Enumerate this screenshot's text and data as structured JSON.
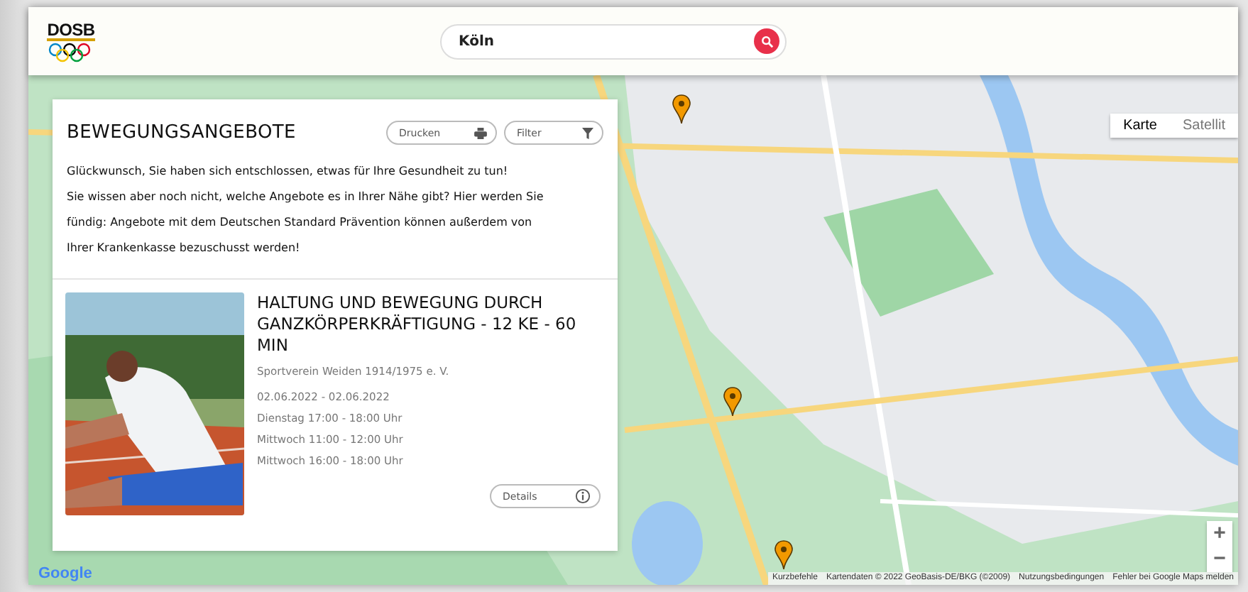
{
  "header": {
    "logo": "DOSB",
    "search": {
      "value": "Köln"
    }
  },
  "panel": {
    "title": "BEWEGUNGSANGEBOTE",
    "buttons": [
      {
        "label": "Drucken",
        "kind": "print"
      },
      {
        "label": "Filter",
        "kind": "filter"
      }
    ],
    "paragraphs": [
      "Glückwunsch, Sie haben sich entschlossen, etwas für Ihre Gesundheit zu tun!",
      "Sie wissen aber noch nicht, welche Angebote es in Ihrer Nähe gibt? Hier werden Sie fündig: Angebote mit dem Deutschen Standard Prävention können außerdem von Ihrer Krankenkasse bezuschusst werden!"
    ],
    "offers": [
      {
        "title": "HALTUNG UND BEWEGUNG DURCH GANZKÖRPERKRÄFTIGUNG - 12 KE - 60 MIN",
        "club": "Sportverein Weiden 1914/1975 e. V.",
        "dates": [
          "02.06.2022 - 02.06.2022",
          "Dienstag 17:00 - 18:00 Uhr",
          "Mittwoch 11:00 - 12:00 Uhr",
          "Mittwoch 16:00 - 18:00 Uhr"
        ],
        "button": "Details"
      }
    ]
  },
  "map": {
    "map_types": [
      {
        "label": "Karte",
        "selected": true
      },
      {
        "label": "Satellit",
        "selected": false
      }
    ],
    "zoom": [
      "+",
      "−"
    ],
    "markers": [
      {
        "kind": "offer"
      },
      {
        "kind": "offer"
      },
      {
        "kind": "offer"
      }
    ],
    "brand": "Google",
    "attribution": [
      "Kurzbefehle",
      "Kartendaten © 2022 GeoBasis-DE/BKG (©2009)",
      "Nutzungsbedingungen",
      "Fehler bei Google Maps melden"
    ]
  }
}
